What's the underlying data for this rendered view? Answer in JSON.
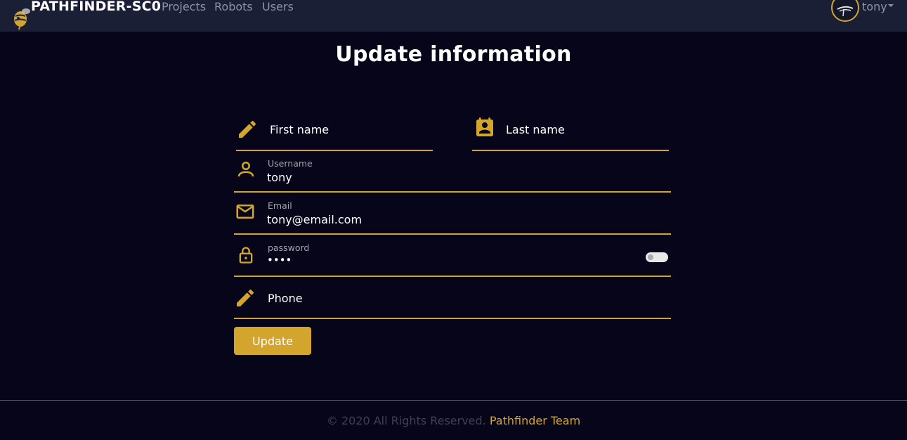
{
  "navbar": {
    "brand": "PATHFINDER-SC0",
    "links": [
      {
        "label": "Projects"
      },
      {
        "label": "Robots"
      },
      {
        "label": "Users"
      }
    ],
    "user": {
      "name": "tony"
    }
  },
  "page": {
    "title": "Update information"
  },
  "form": {
    "first_name": {
      "placeholder": "First name",
      "value": ""
    },
    "last_name": {
      "placeholder": "Last name",
      "value": ""
    },
    "username": {
      "label": "Username",
      "value": "tony"
    },
    "email": {
      "label": "Email",
      "value": "tony@email.com"
    },
    "password": {
      "label": "password",
      "value": "••••",
      "show_password": false
    },
    "phone": {
      "placeholder": "Phone",
      "value": ""
    },
    "submit_label": "Update"
  },
  "footer": {
    "copyright": "© 2020 All Rights Reserved.",
    "team": "Pathfinder Team"
  },
  "colors": {
    "accent": "#d4a52c",
    "background": "#06051a",
    "navbar": "#1a1f36"
  }
}
